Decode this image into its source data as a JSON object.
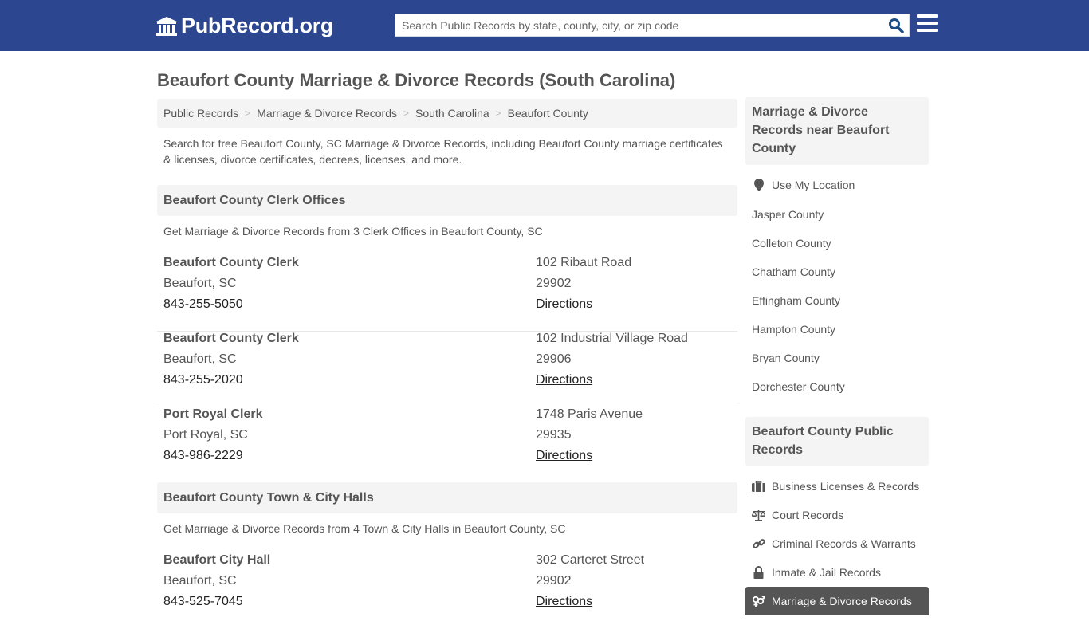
{
  "header": {
    "logo_text": "PubRecord.org",
    "search_placeholder": "Search Public Records by state, county, city, or zip code",
    "search_value": ""
  },
  "page_title": "Beaufort County Marriage & Divorce Records (South Carolina)",
  "breadcrumb": [
    {
      "label": "Public Records"
    },
    {
      "label": "Marriage & Divorce Records"
    },
    {
      "label": "South Carolina"
    },
    {
      "label": "Beaufort County"
    }
  ],
  "intro": "Search for free Beaufort County, SC Marriage & Divorce Records, including Beaufort County marriage certificates & licenses, divorce certificates, decrees, licenses, and more.",
  "sections": [
    {
      "title": "Beaufort County Clerk Offices",
      "subtitle": "Get Marriage & Divorce Records from 3 Clerk Offices in Beaufort County, SC",
      "entries": [
        {
          "name": "Beaufort County Clerk",
          "city": "Beaufort, SC",
          "phone": "843-255-5050",
          "address": "102 Ribaut Road",
          "zip": "29902",
          "directions": "Directions"
        },
        {
          "name": "Beaufort County Clerk",
          "city": "Beaufort, SC",
          "phone": "843-255-2020",
          "address": "102 Industrial Village Road",
          "zip": "29906",
          "directions": "Directions"
        },
        {
          "name": "Port Royal Clerk",
          "city": "Port Royal, SC",
          "phone": "843-986-2229",
          "address": "1748 Paris Avenue",
          "zip": "29935",
          "directions": "Directions"
        }
      ]
    },
    {
      "title": "Beaufort County Town & City Halls",
      "subtitle": "Get Marriage & Divorce Records from 4 Town & City Halls in Beaufort County, SC",
      "entries": [
        {
          "name": "Beaufort City Hall",
          "city": "Beaufort, SC",
          "phone": "843-525-7045",
          "address": "302 Carteret Street",
          "zip": "29902",
          "directions": "Directions"
        }
      ]
    }
  ],
  "sidebar": {
    "nearby_title": "Marriage & Divorce Records near Beaufort County",
    "use_location": "Use My Location",
    "nearby": [
      "Jasper County",
      "Colleton County",
      "Chatham County",
      "Effingham County",
      "Hampton County",
      "Bryan County",
      "Dorchester County"
    ],
    "public_title": "Beaufort County Public Records",
    "public": [
      {
        "label": "Business Licenses & Records",
        "icon": "briefcase-icon"
      },
      {
        "label": "Court Records",
        "icon": "scale-icon"
      },
      {
        "label": "Criminal Records & Warrants",
        "icon": "link-icon"
      },
      {
        "label": "Inmate & Jail Records",
        "icon": "lock-icon"
      },
      {
        "label": "Marriage & Divorce Records",
        "icon": "gender-icon",
        "active": true
      }
    ]
  },
  "colors": {
    "brand": "#2d4690",
    "search_icon": "#1d4e89",
    "panel_bg": "#f4f4f4",
    "active_bg": "#555555"
  }
}
